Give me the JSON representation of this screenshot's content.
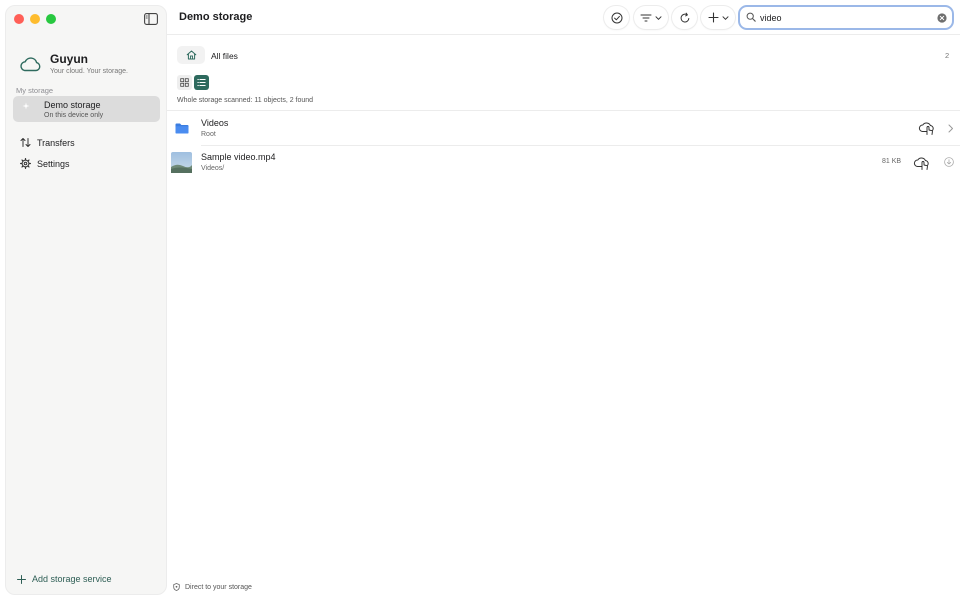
{
  "sidebar": {
    "brand_name": "Guyun",
    "brand_tagline": "Your cloud. Your storage.",
    "section_label": "My storage",
    "storage": {
      "name": "Demo storage",
      "subtitle": "On this device only"
    },
    "nav": [
      {
        "label": "Transfers",
        "icon": "arrows-up-down-icon"
      },
      {
        "label": "Settings",
        "icon": "gear-icon"
      }
    ],
    "add_storage_label": "Add storage service"
  },
  "toolbar": {
    "title": "Demo storage",
    "search_value": "video"
  },
  "content": {
    "breadcrumb": "All files",
    "count": "2",
    "scan_status": "Whole storage scanned: 11 objects, 2 found",
    "items": [
      {
        "name": "Videos",
        "sub": "Root",
        "kind": "folder"
      },
      {
        "name": "Sample video.mp4",
        "sub": "Videos/",
        "size": "81 KB",
        "kind": "file"
      }
    ]
  },
  "footer": {
    "label": "Direct to your storage"
  },
  "colors": {
    "accent": "#2e6a5e",
    "folder": "#3b7de0",
    "search_ring": "#9bb8e8"
  }
}
